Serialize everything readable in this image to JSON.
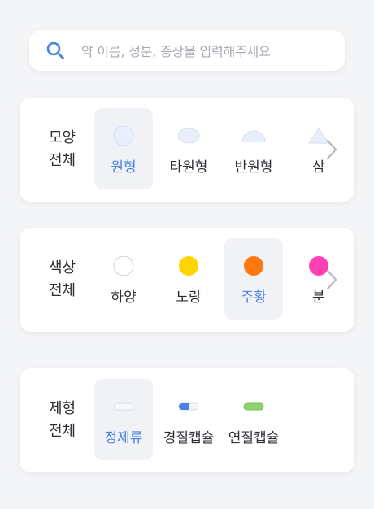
{
  "search": {
    "placeholder": "약 이름, 성분, 증상을 입력해주세요"
  },
  "shape": {
    "title_line1": "모양",
    "title_line2": "전체",
    "options": [
      {
        "label": "원형",
        "selected": true
      },
      {
        "label": "타원형",
        "selected": false
      },
      {
        "label": "반원형",
        "selected": false
      },
      {
        "label": "삼",
        "selected": false
      }
    ]
  },
  "color": {
    "title_line1": "색상",
    "title_line2": "전체",
    "options": [
      {
        "label": "하양",
        "swatch": "#ffffff",
        "selected": false
      },
      {
        "label": "노랑",
        "swatch": "#ffd400",
        "selected": false
      },
      {
        "label": "주황",
        "swatch": "#ff7710",
        "selected": true
      },
      {
        "label": "분",
        "swatch": "#ff3fb4",
        "selected": false
      }
    ]
  },
  "form": {
    "title_line1": "제형",
    "title_line2": "전체",
    "options": [
      {
        "label": "정제류",
        "selected": true
      },
      {
        "label": "경질캡슐",
        "selected": false
      },
      {
        "label": "연질캡슐",
        "selected": false
      }
    ]
  },
  "colors": {
    "accent": "#4a82e0",
    "text": "#2b2d33",
    "placeholder": "#a6a9b1",
    "selected_bg": "#f1f2f5"
  }
}
